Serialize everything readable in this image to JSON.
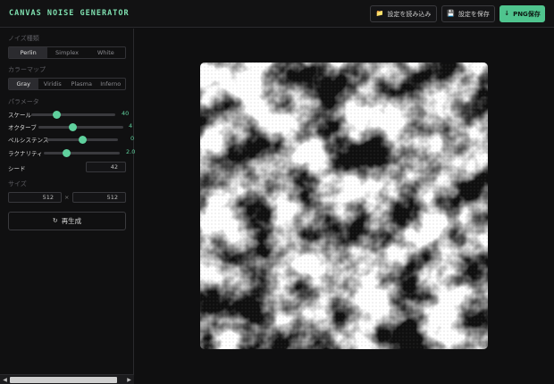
{
  "app": {
    "title": "CANVAS NOISE GENERATOR"
  },
  "header": {
    "load_label": "設定を読み込み",
    "save_label": "設定を保存",
    "png_label": "PNG保存"
  },
  "sidebar": {
    "noise_type": {
      "label": "ノイズ種類",
      "options": [
        "Perlin",
        "Simplex",
        "White"
      ],
      "selected": "Perlin"
    },
    "colormap": {
      "label": "カラーマップ",
      "options": [
        "Gray",
        "Viridis",
        "Plasma",
        "Inferno"
      ],
      "selected": "Gray"
    },
    "params": {
      "label": "パラメータ",
      "scale": {
        "label": "スケール",
        "value": "40",
        "level": 0.3
      },
      "octaves": {
        "label": "オクターブ",
        "value": "4",
        "level": 0.4
      },
      "persistence": {
        "label": "ペルシステンス",
        "value": "0",
        "level": 0.5
      },
      "lacunarity": {
        "label": "ラクナリティ",
        "value": "2.0",
        "level": 0.3
      }
    },
    "seed": {
      "label": "シード",
      "value": "42"
    },
    "size": {
      "label": "サイズ",
      "width": "512",
      "separator": "×",
      "height": "512"
    },
    "regenerate_label": "再生成"
  },
  "colors": {
    "accent": "#5fd09d",
    "background": "#0f0f10",
    "panel": "#101011"
  },
  "icons": {
    "load": "folder-icon",
    "save": "floppy-icon",
    "png": "download-icon",
    "regen": "refresh-icon"
  }
}
